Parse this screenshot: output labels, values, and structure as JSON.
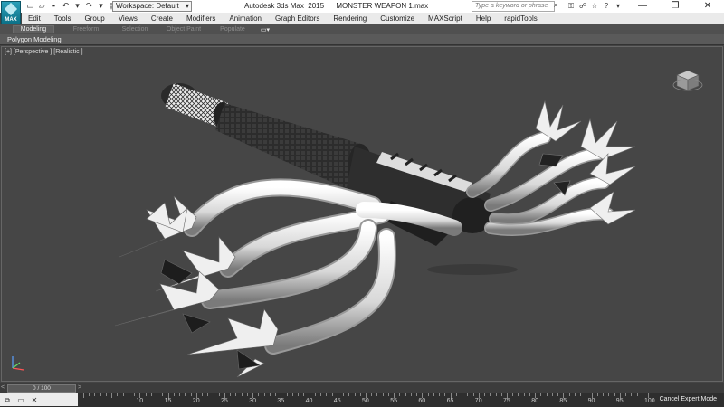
{
  "app": {
    "logo_text": "MAX",
    "window_title": "Autodesk 3ds Max  2015      MONSTER WEAPON 1.max",
    "workspace_label": "Workspace: Default",
    "search_placeholder": "Type a keyword or phrase"
  },
  "menu": [
    "Edit",
    "Tools",
    "Group",
    "Views",
    "Create",
    "Modifiers",
    "Animation",
    "Graph Editors",
    "Rendering",
    "Customize",
    "MAXScript",
    "Help",
    "rapidTools"
  ],
  "ribbon": {
    "tabs": [
      "Modeling",
      "Freeform",
      "Selection",
      "Object Paint",
      "Populate"
    ],
    "active_tab": "Modeling",
    "panel_label": "Polygon Modeling"
  },
  "viewport": {
    "label": "[+] [Perspective ] [Realistic ]"
  },
  "timeline": {
    "frame_readout": "0 / 100",
    "left_arrow": "<",
    "right_arrow": ">",
    "ruler_labels": [
      "10",
      "15",
      "20",
      "25",
      "30",
      "35",
      "40",
      "45",
      "50",
      "55",
      "60",
      "65",
      "70",
      "75",
      "80",
      "85",
      "90",
      "95",
      "100"
    ]
  },
  "status": {
    "cancel_expert_mode": "Cancel Expert Mode"
  },
  "colors": {
    "accent": "#1f8fa8",
    "viewport_bg": "#464646",
    "model_body": "#e8e8e8",
    "model_dark": "#2a2a2a"
  }
}
